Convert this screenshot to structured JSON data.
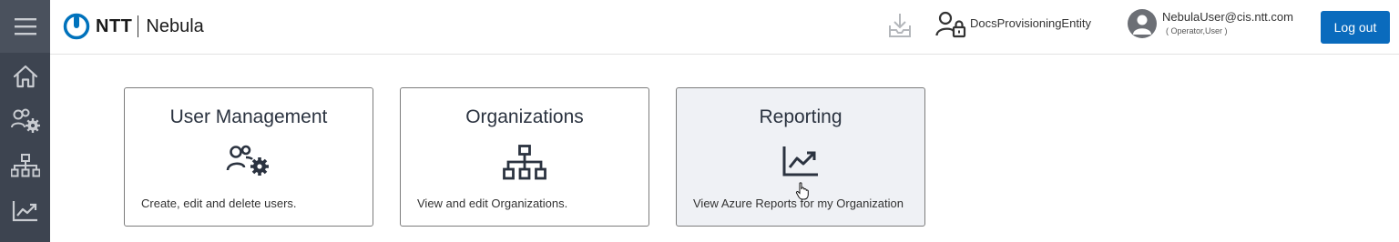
{
  "header": {
    "logo_brand": "NTT",
    "app_name": "Nebula",
    "entity_name": "DocsProvisioningEntity",
    "user_email": "NebulaUser@cis.ntt.com",
    "user_roles": "( Operator,User )",
    "logout_label": "Log out"
  },
  "sidebar": {
    "items": [
      {
        "icon": "home-icon"
      },
      {
        "icon": "user-settings-icon"
      },
      {
        "icon": "organization-icon"
      },
      {
        "icon": "chart-icon"
      }
    ]
  },
  "cards": [
    {
      "title": "User Management",
      "icon": "user-settings-icon",
      "description": "Create, edit and delete users."
    },
    {
      "title": "Organizations",
      "icon": "organization-icon",
      "description": "View and edit Organizations."
    },
    {
      "title": "Reporting",
      "icon": "chart-icon",
      "description": "View Azure Reports for my Organization"
    }
  ],
  "colors": {
    "rail": "#3d4450",
    "accent": "#0a6bbd",
    "card_active_bg": "#eff1f5",
    "brand_blue": "#0072bc"
  }
}
